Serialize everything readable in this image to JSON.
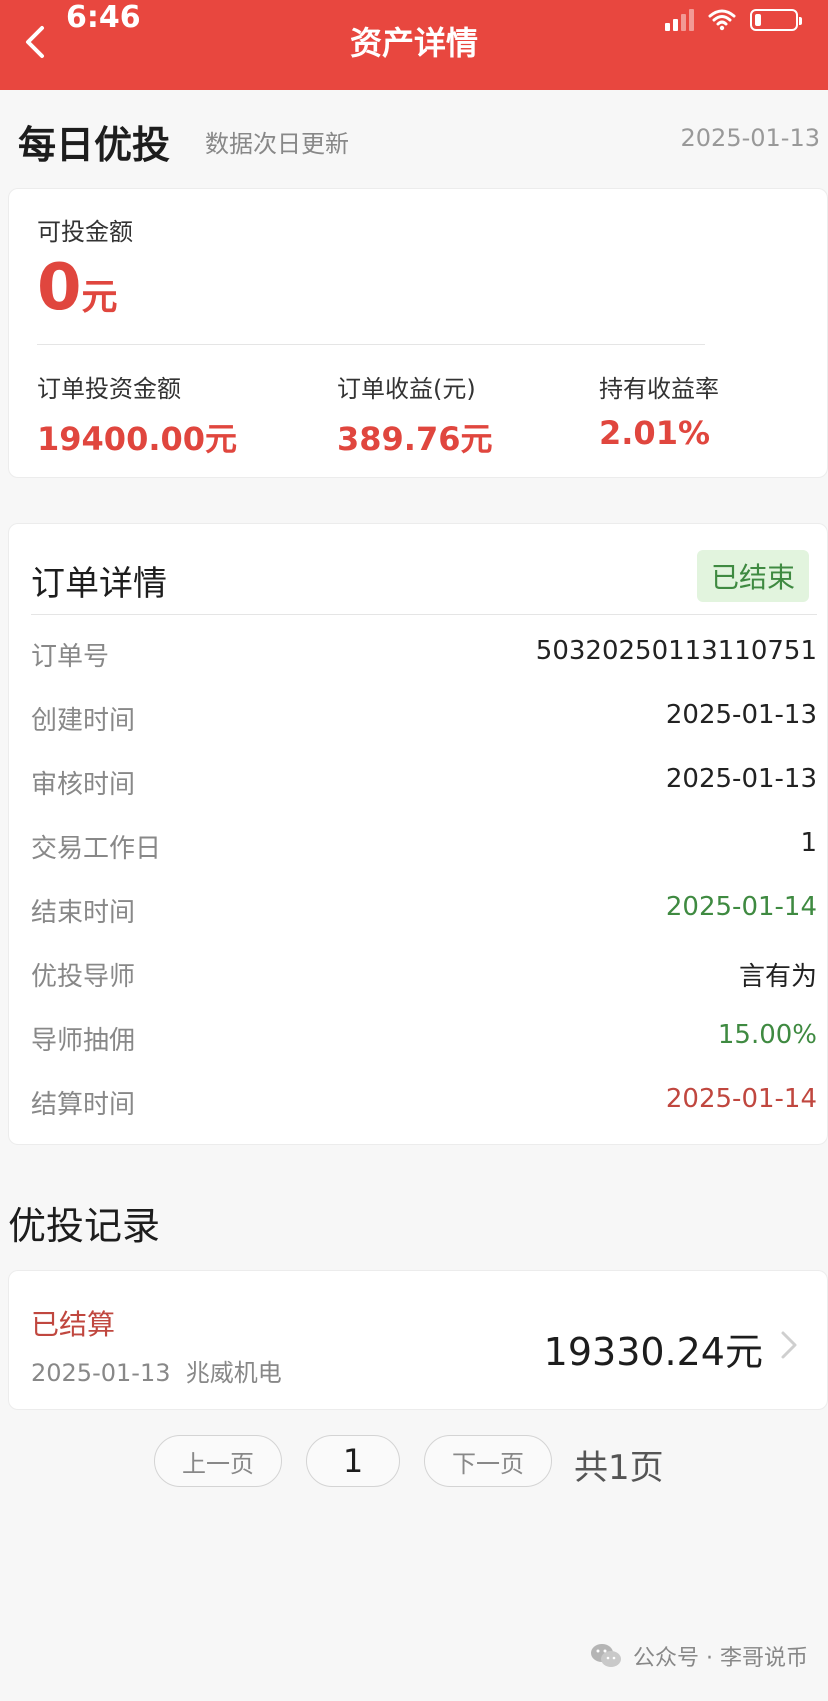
{
  "status_bar": {
    "time": "6:46"
  },
  "nav": {
    "title": "资产详情"
  },
  "header": {
    "title": "每日优投",
    "subtitle": "数据次日更新",
    "date": "2025-01-13"
  },
  "summary": {
    "available_label": "可投金额",
    "available_value": "0",
    "available_unit": "元",
    "stats": [
      {
        "label": "订单投资金额",
        "value": "19400.00元"
      },
      {
        "label": "订单收益(元)",
        "value": "389.76元"
      },
      {
        "label": "持有收益率",
        "value": "2.01%"
      }
    ]
  },
  "order": {
    "title": "订单详情",
    "status_badge": "已结束",
    "rows": [
      {
        "label": "订单号",
        "value": "50320250113110751",
        "tone": "normal"
      },
      {
        "label": "创建时间",
        "value": "2025-01-13",
        "tone": "normal"
      },
      {
        "label": "审核时间",
        "value": "2025-01-13",
        "tone": "normal"
      },
      {
        "label": "交易工作日",
        "value": "1",
        "tone": "normal"
      },
      {
        "label": "结束时间",
        "value": "2025-01-14",
        "tone": "green"
      },
      {
        "label": "优投导师",
        "value": "言有为",
        "tone": "normal"
      },
      {
        "label": "导师抽佣",
        "value": "15.00%",
        "tone": "green"
      },
      {
        "label": "结算时间",
        "value": "2025-01-14",
        "tone": "red"
      }
    ]
  },
  "records": {
    "title": "优投记录",
    "items": [
      {
        "status": "已结算",
        "date": "2025-01-13",
        "name": "兆威机电",
        "amount": "19330.24元"
      }
    ]
  },
  "pagination": {
    "prev_label": "上一页",
    "current": "1",
    "next_label": "下一页",
    "total": "共1页"
  },
  "footer": {
    "text": "公众号 · 李哥说币"
  },
  "colors": {
    "brand_red": "#e8473f",
    "value_red": "#e0463e",
    "green": "#3f8a41"
  }
}
